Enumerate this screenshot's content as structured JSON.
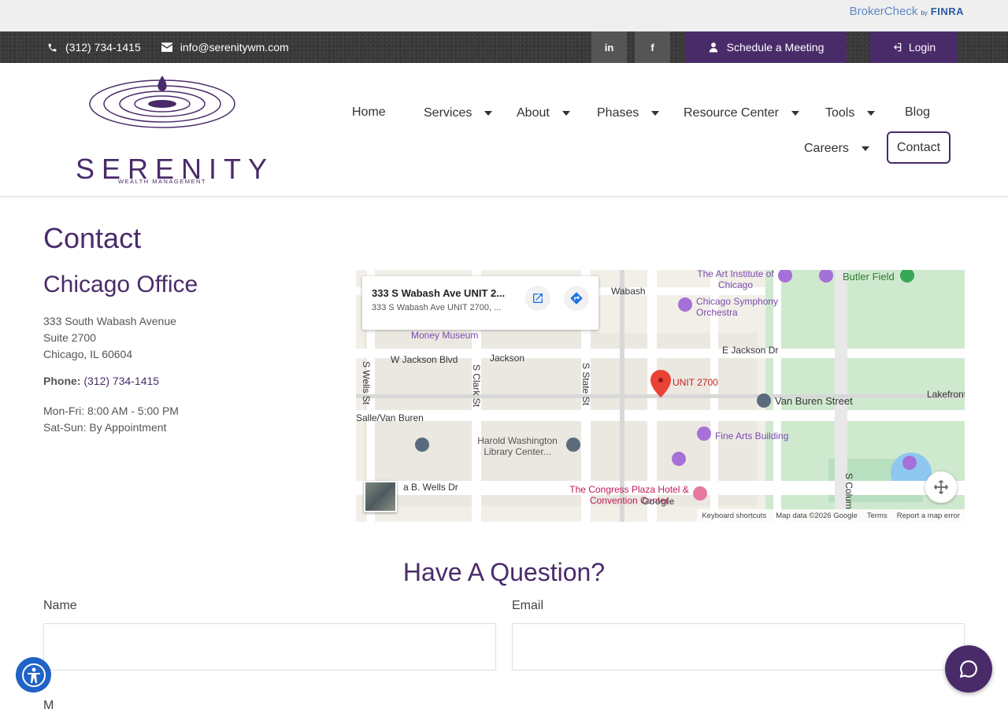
{
  "brokercheck": {
    "main": "BrokerCheck",
    "by": "by",
    "finra": "FINRA"
  },
  "utility": {
    "phone": "(312) 734-1415",
    "email": "info@serenitywm.com",
    "linkedin": "in",
    "facebook": "f",
    "schedule": "Schedule a Meeting",
    "login": "Login"
  },
  "logo": {
    "name": "SERENITY",
    "tagline": "WEALTH MANAGEMENT"
  },
  "nav": {
    "home": "Home",
    "services": "Services",
    "about": "About",
    "phases": "Phases",
    "resource_center": "Resource Center",
    "tools": "Tools",
    "blog": "Blog",
    "careers": "Careers",
    "contact": "Contact"
  },
  "page": {
    "title": "Contact",
    "office_title": "Chicago Office"
  },
  "office": {
    "street": "333 South Wabash Avenue",
    "suite": "Suite 2700",
    "city": "Chicago, IL 60604",
    "phone_label": "Phone:",
    "phone": "(312) 734-1415",
    "hours_weekday": "Mon-Fri: 8:00 AM - 5:00 PM",
    "hours_weekend": "Sat-Sun: By Appointment"
  },
  "map": {
    "card_title": "333 S Wabash Ave UNIT 2...",
    "card_subtitle": "333 S Wabash Ave UNIT 2700, ...",
    "labels": {
      "wabash": "Wabash",
      "art_institute": "The Art Institute of Chicago",
      "butler": "Butler Field",
      "symphony": "Chicago Symphony Orchestra",
      "money": "Money Museum",
      "jackson_blvd": "W Jackson Blvd",
      "jackson": "Jackson",
      "e_jackson": "E Jackson Dr",
      "unit": "UNIT 2700",
      "van_buren_st": "Van Buren Street",
      "lakefront": "Lakefront P",
      "salle_van_buren": "Salle/Van Buren",
      "harold": "Harold Washington Library Center...",
      "fine_arts": "Fine Arts Building",
      "wells_dr": "a B. Wells Dr",
      "congress": "The Congress Plaza Hotel & Convention Center",
      "s_wells": "S Wells St",
      "s_clark": "S Clark St",
      "s_state": "S State St",
      "s_columbus": "S Colum"
    },
    "google": "Google",
    "footer": {
      "shortcuts": "Keyboard shortcuts",
      "data": "Map data ©2026 Google",
      "terms": "Terms",
      "report": "Report a map error"
    }
  },
  "form": {
    "heading": "Have A Question?",
    "name_label": "Name",
    "email_label": "Email",
    "message_label": "M"
  },
  "colors": {
    "brand": "#4a2b6a",
    "accessibility": "#1f63c6"
  }
}
